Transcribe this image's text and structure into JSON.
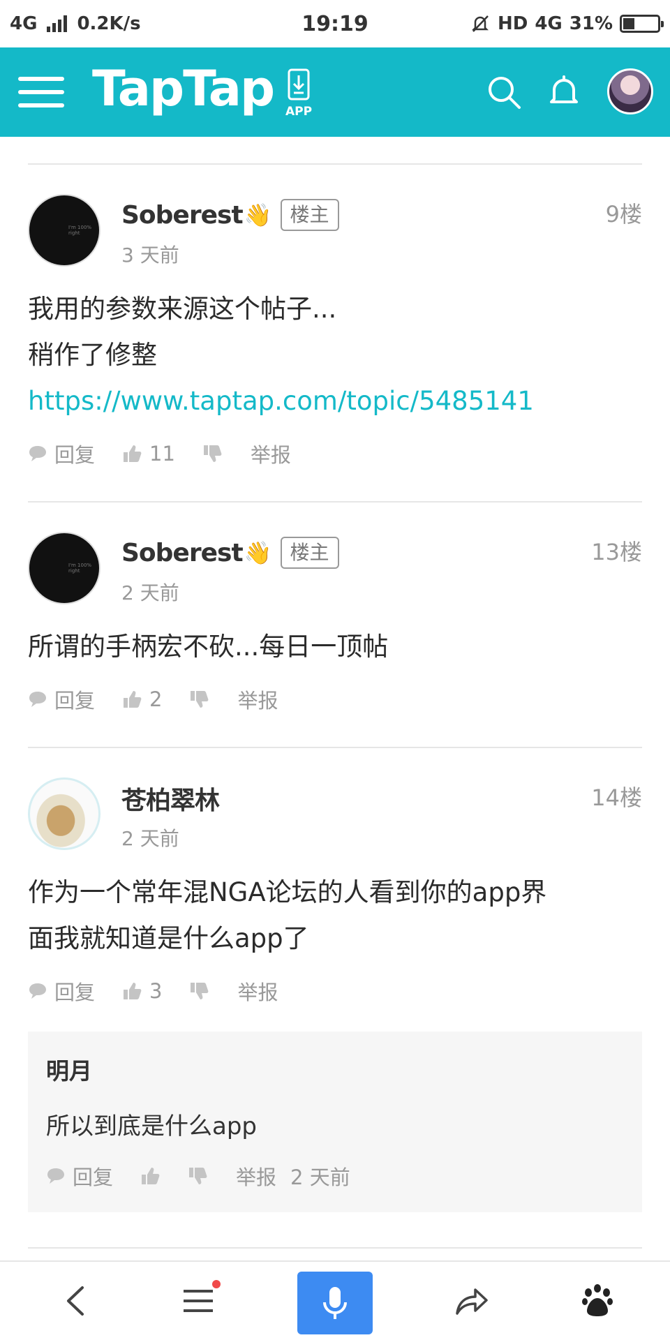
{
  "status_bar": {
    "network": "4G",
    "speed": "0.2K/s",
    "time": "19:19",
    "hd": "HD",
    "network_right": "4G",
    "battery": "31%",
    "battery_level": 0.31
  },
  "header": {
    "logo": "TapTap",
    "app_label": "APP",
    "brand_color": "#14b9c8"
  },
  "posts": [
    {
      "author": "Soberest",
      "emoji": "👋",
      "badge": "楼主",
      "floor": "9楼",
      "time": "3 天前",
      "lines": [
        "我用的参数来源这个帖子...",
        "稍作了修整"
      ],
      "link": "https://www.taptap.com/topic/5485141",
      "reply_label": "回复",
      "like_count": "11",
      "report_label": "举报"
    },
    {
      "author": "Soberest",
      "emoji": "👋",
      "badge": "楼主",
      "floor": "13楼",
      "time": "2 天前",
      "lines": [
        "所谓的手柄宏不砍...每日一顶帖"
      ],
      "reply_label": "回复",
      "like_count": "2",
      "report_label": "举报"
    },
    {
      "author": "苍柏翠林",
      "floor": "14楼",
      "time": "2 天前",
      "lines": [
        "作为一个常年混NGA论坛的人看到你的app界",
        "面我就知道是什么app了"
      ],
      "reply_label": "回复",
      "like_count": "3",
      "report_label": "举报",
      "reply": {
        "author": "明月",
        "text": "所以到底是什么app",
        "reply_label": "回复",
        "report_label": "举报",
        "time": "2 天前"
      }
    }
  ],
  "bottom_nav": {
    "accent": "#3d8bf2",
    "icons": [
      "back-icon",
      "menu-icon",
      "microphone-icon",
      "share-icon",
      "baidu-paw-icon"
    ]
  }
}
